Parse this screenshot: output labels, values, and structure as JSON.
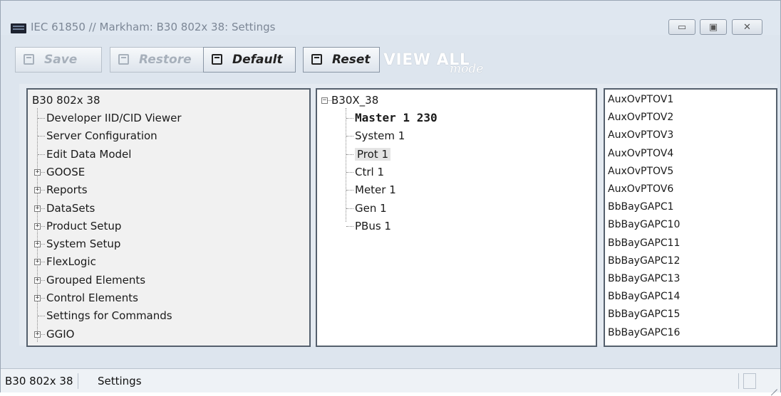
{
  "window": {
    "title": "IEC 61850 // Markham: B30 802x 38: Settings",
    "controls": {
      "minimize": "▭",
      "maximize": "▣",
      "close": "✕"
    }
  },
  "toolbar": {
    "save_label": "Save",
    "restore_label": "Restore",
    "default_label": "Default",
    "reset_label": "Reset",
    "view_all_label": "VIEW ALL",
    "view_all_mode": "mode"
  },
  "left_tree": {
    "root": "B30 802x 38",
    "items": [
      {
        "label": "Developer IID/CID Viewer",
        "expandable": false
      },
      {
        "label": "Server Configuration",
        "expandable": false
      },
      {
        "label": "Edit Data Model",
        "expandable": false
      },
      {
        "label": "GOOSE",
        "expandable": true
      },
      {
        "label": "Reports",
        "expandable": true
      },
      {
        "label": "DataSets",
        "expandable": true
      },
      {
        "label": "Product Setup",
        "expandable": true
      },
      {
        "label": "System Setup",
        "expandable": true
      },
      {
        "label": "FlexLogic",
        "expandable": true
      },
      {
        "label": "Grouped Elements",
        "expandable": true
      },
      {
        "label": "Control Elements",
        "expandable": true
      },
      {
        "label": "Settings for Commands",
        "expandable": false
      },
      {
        "label": "GGIO",
        "expandable": true
      }
    ]
  },
  "mid_tree": {
    "root": "B30X_38",
    "items": [
      {
        "label": "Master  1 230",
        "bold": true
      },
      {
        "label": "System  1",
        "bold": false
      },
      {
        "label": "Prot  1",
        "bold": false,
        "selected": true
      },
      {
        "label": "Ctrl  1",
        "bold": false
      },
      {
        "label": "Meter  1",
        "bold": false
      },
      {
        "label": "Gen  1",
        "bold": false
      },
      {
        "label": "PBus  1",
        "bold": false
      }
    ]
  },
  "right_list": {
    "items": [
      "AuxOvPTOV1",
      "AuxOvPTOV2",
      "AuxOvPTOV3",
      "AuxOvPTOV4",
      "AuxOvPTOV5",
      "AuxOvPTOV6",
      "BbBayGAPC1",
      "BbBayGAPC10",
      "BbBayGAPC11",
      "BbBayGAPC12",
      "BbBayGAPC13",
      "BbBayGAPC14",
      "BbBayGAPC15",
      "BbBayGAPC16"
    ]
  },
  "status_bar": {
    "device": "B30 802x 38",
    "section": "Settings"
  }
}
